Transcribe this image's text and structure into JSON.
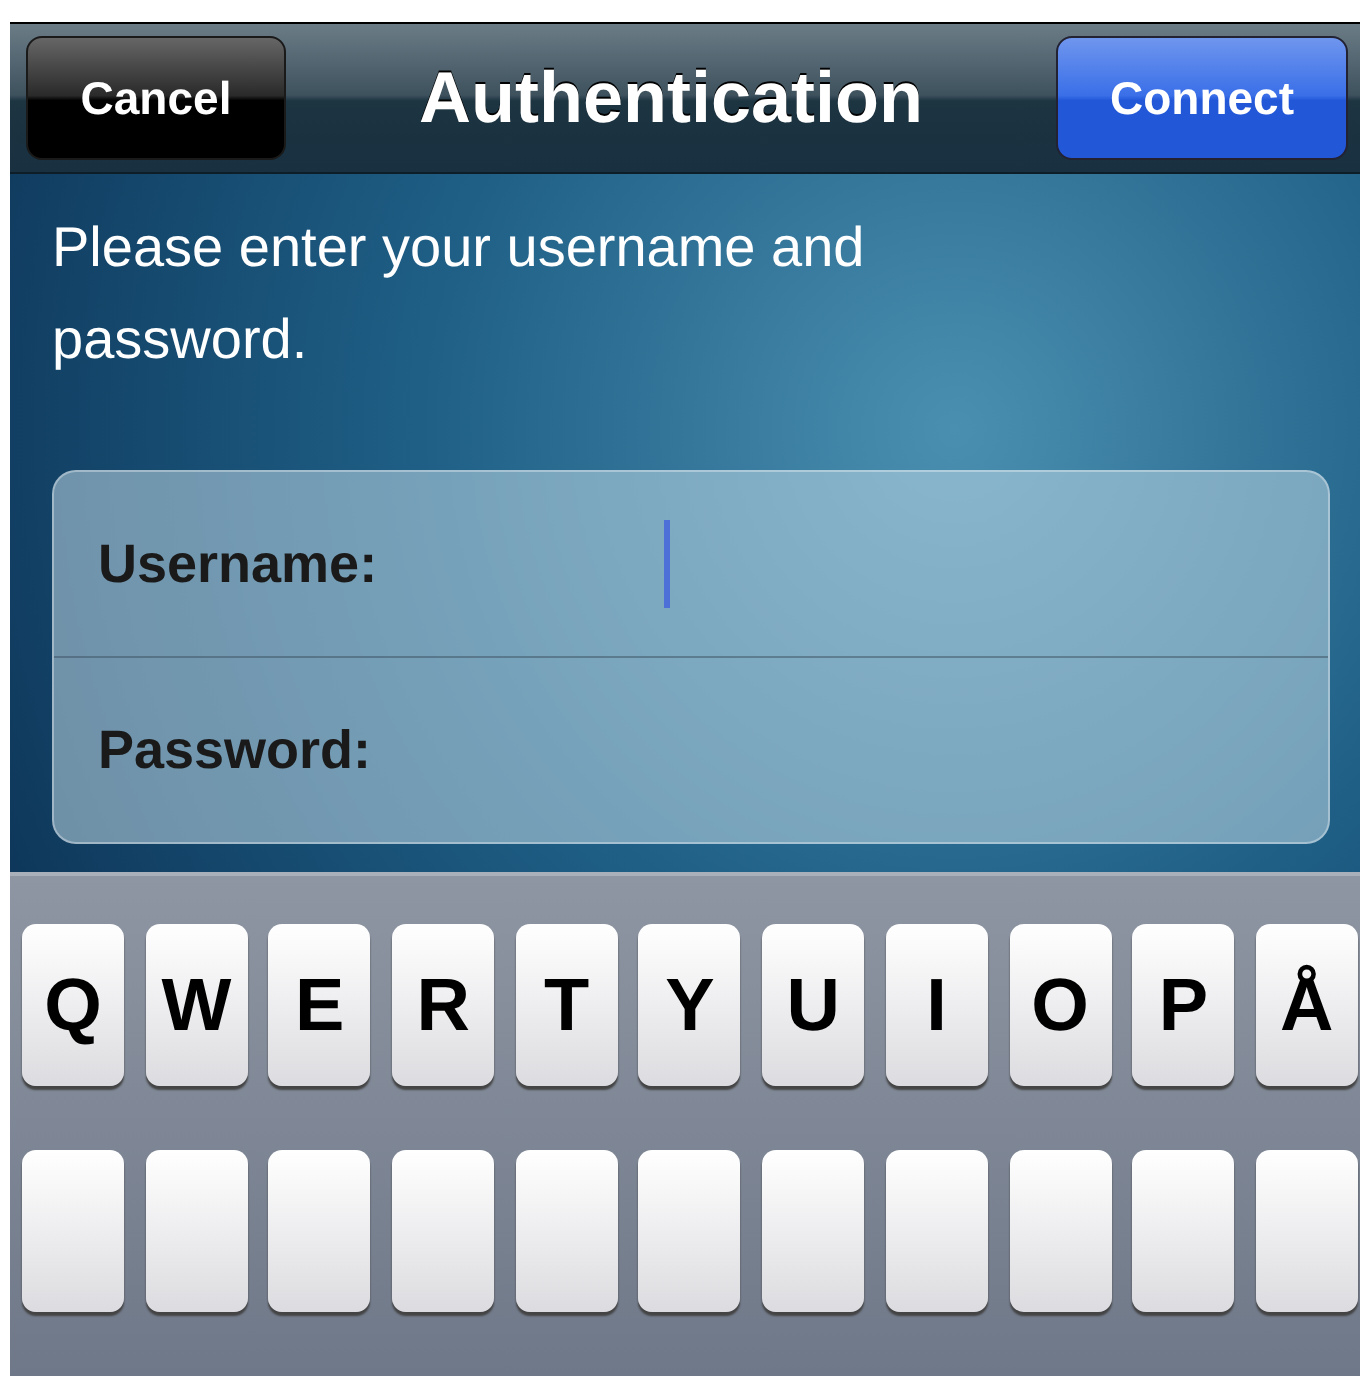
{
  "nav_bar": {
    "left_button": "Cancel",
    "title": "Authentication",
    "right_button": "Connect"
  },
  "instructions": "Please enter your username and password.",
  "form": {
    "fields": [
      {
        "label": "Username:",
        "focused": true
      },
      {
        "label": "Password:",
        "focused": false
      }
    ]
  },
  "keyboard": {
    "rows": [
      [
        "Q",
        "W",
        "E",
        "R",
        "T",
        "Y",
        "U",
        "I",
        "O",
        "P",
        "Å"
      ]
    ]
  }
}
